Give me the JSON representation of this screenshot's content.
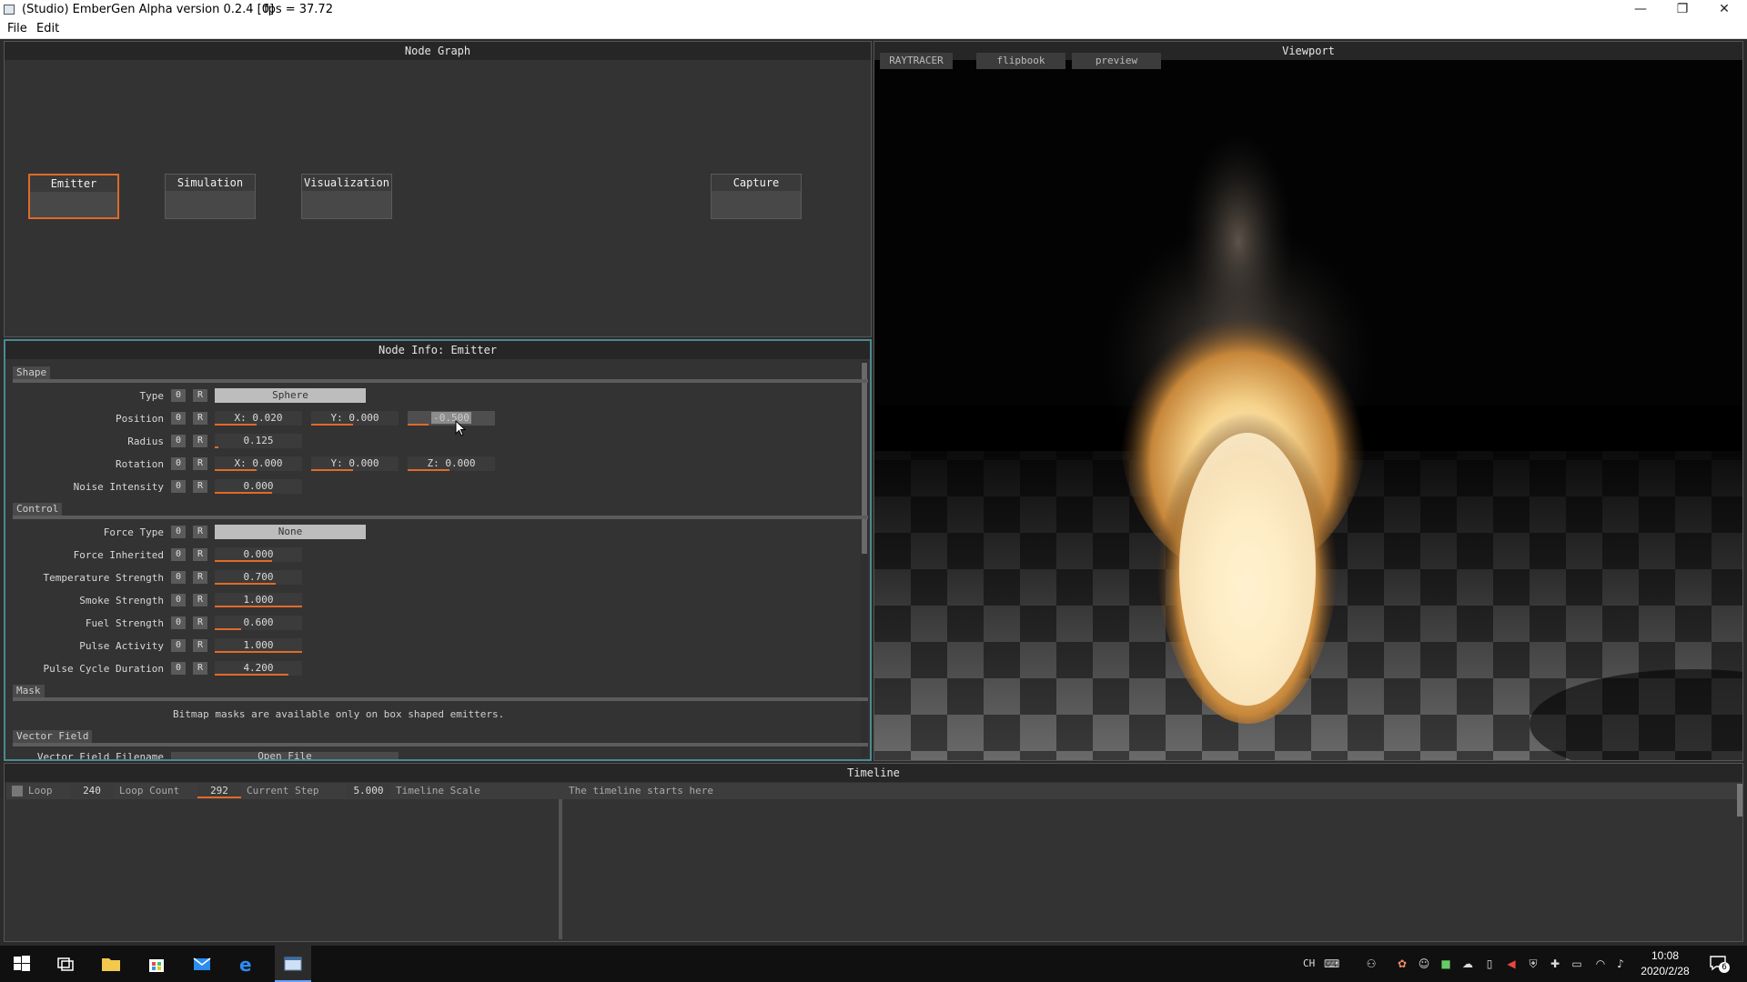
{
  "window": {
    "title": "(Studio) EmberGen Alpha version 0.2.4 [0]",
    "fps": "fps = 37.72",
    "minimize": "—",
    "restore": "❐",
    "close": "✕"
  },
  "menu": {
    "file": "File",
    "edit": "Edit"
  },
  "node_graph": {
    "title": "Node Graph",
    "nodes": [
      {
        "label": "Emitter"
      },
      {
        "label": "Simulation"
      },
      {
        "label": "Visualization"
      },
      {
        "label": "Capture"
      }
    ]
  },
  "node_info": {
    "title": "Node Info: Emitter",
    "zero_btn": "0",
    "reset_btn": "R",
    "sections": {
      "shape": "Shape",
      "control": "Control",
      "mask": "Mask",
      "vector_field": "Vector Field"
    },
    "type": {
      "label": "Type",
      "value": "Sphere"
    },
    "position": {
      "label": "Position",
      "x": "X: 0.020",
      "y": "Y: 0.000",
      "z": "-0.500"
    },
    "radius": {
      "label": "Radius",
      "value": "0.125"
    },
    "rotation": {
      "label": "Rotation",
      "x": "X: 0.000",
      "y": "Y: 0.000",
      "z": "Z: 0.000"
    },
    "noise_intensity": {
      "label": "Noise Intensity",
      "value": "0.000"
    },
    "force_type": {
      "label": "Force Type",
      "value": "None"
    },
    "force_inherited": {
      "label": "Force Inherited",
      "value": "0.000"
    },
    "temperature_strength": {
      "label": "Temperature Strength",
      "value": "0.700",
      "level": 0.7
    },
    "smoke_strength": {
      "label": "Smoke Strength",
      "value": "1.000",
      "level": 1.0
    },
    "fuel_strength": {
      "label": "Fuel Strength",
      "value": "0.600",
      "level": 0.3
    },
    "pulse_activity": {
      "label": "Pulse Activity",
      "value": "1.000",
      "level": 1.0
    },
    "pulse_cycle_duration": {
      "label": "Pulse Cycle Duration",
      "value": "4.200",
      "level": 0.84
    },
    "mask_note": "Bitmap masks are available only on box shaped emitters.",
    "vector_field_filename": {
      "label": "Vector Field Filename",
      "button": "Open File"
    }
  },
  "viewport": {
    "title": "Viewport",
    "tabs": [
      "RAYTRACER",
      "flipbook",
      "preview"
    ]
  },
  "timeline": {
    "title": "Timeline",
    "loop_label": "Loop",
    "loop_count_value": "240",
    "loop_count_label": "Loop Count",
    "current_step_value": "292",
    "current_step_label": "Current Step",
    "timeline_scale_value": "5.000",
    "timeline_scale_label": "Timeline Scale",
    "note": "The timeline starts here"
  },
  "taskbar": {
    "ime": "CH",
    "time": "10:08",
    "date": "2020/2/28",
    "notifications": "6"
  },
  "colors": {
    "accent": "#e06a2a",
    "panel": "#333333",
    "header": "#262626",
    "teal_border": "#4a8a8f"
  }
}
